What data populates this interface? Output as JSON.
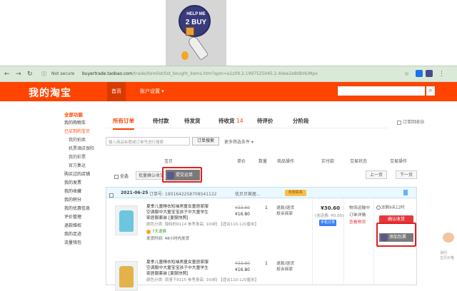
{
  "logo": {
    "line1": "HELP ME",
    "line2": "2 BUY"
  },
  "browser": {
    "secure_label": "Not secure",
    "url_domain": "buyertrade.taobao.com",
    "url_path": "/trade/itemlist/list_bought_items.htm?spm=a1z09.2.1997525045.2.4dee2e8dbHUMpx"
  },
  "nav": {
    "brand": "我的淘宝",
    "tabs": [
      "首页",
      "账户设置 ▾"
    ]
  },
  "sidebar": {
    "items": [
      {
        "label": "全部功能",
        "style": "head"
      },
      {
        "label": "我的购物车",
        "style": ""
      },
      {
        "label": "已买到的宝贝",
        "style": "hl"
      },
      {
        "label": "我的拍卖",
        "style": "sub"
      },
      {
        "label": "机票酒店保险",
        "style": "sub"
      },
      {
        "label": "我的彩票",
        "style": "sub"
      },
      {
        "label": "官方集运",
        "style": "sub"
      },
      {
        "label": "购买过的店铺",
        "style": ""
      },
      {
        "label": "我的发票",
        "style": ""
      },
      {
        "label": "我的收藏",
        "style": ""
      },
      {
        "label": "我的积分",
        "style": ""
      },
      {
        "label": "我的优惠信息",
        "style": ""
      },
      {
        "label": "评价管理",
        "style": ""
      },
      {
        "label": "退款维权",
        "style": ""
      },
      {
        "label": "我的足迹",
        "style": ""
      },
      {
        "label": "流量钱包",
        "style": ""
      }
    ]
  },
  "tabs": [
    {
      "label": "所有订单",
      "count": ""
    },
    {
      "label": "待付款",
      "count": ""
    },
    {
      "label": "待发货",
      "count": ""
    },
    {
      "label": "待收货",
      "count": "14"
    },
    {
      "label": "待评价",
      "count": ""
    },
    {
      "label": "分阶段",
      "count": ""
    }
  ],
  "recycle_label": "订单回收站",
  "search": {
    "placeholder": "输入商品标题或订单号进行搜索",
    "button": "订单搜索",
    "more": "更多筛选条件 ▾"
  },
  "table_header": [
    "宝贝",
    "单价",
    "数量",
    "商品操作",
    "实付款",
    "交易状态",
    "交易操作"
  ],
  "toolbar": {
    "select_all": "全选",
    "batch_confirm": "批量确认收货",
    "submit_order": "提交运单",
    "prev_page": "上一页",
    "next_page": "下一页"
  },
  "order": {
    "date": "2021-06-25",
    "order_no": "订单号: 1901642258708541122",
    "shop": "优贝贝家居...",
    "shop_badge": "和我联系",
    "total": "¥30.60",
    "total_sub": "(含运费: ¥0.00)",
    "pay_badge": "手机订单",
    "status_lines": [
      "物流运输中",
      "订单详情",
      "查看物流"
    ],
    "deadline": "还剩9天12时",
    "confirm_btn": "确认收货",
    "add_package": "添加包裹",
    "products": [
      {
        "name": "夏季儿童睡衣短袖男童女童居家服空调服中大童宝宝孩子中大童学生家居服套装 [夏服快照]",
        "meta": "颜色分类: 独特的9114  参考身高: 100码 【适合110-120厘米】",
        "tag": "7天退换",
        "ship": "发货时间: 48小时内发货",
        "price_old": "¥33.60",
        "price_new": "¥16.80",
        "qty": "1",
        "ops": [
          "退款/退货",
          "投诉商家"
        ],
        "color": "#6cc6dd"
      },
      {
        "name": "夏季儿童睡衣短袖男童女童居家服空调服中大童宝宝孩子中大童学生家居服套装 [夏服快照]",
        "meta": "颜色分类: 浪漫下9115  参考身高: 100码 【适合110-120厘米】",
        "tag": "",
        "ship": "",
        "price_old": "¥33.60",
        "price_new": "¥16.80",
        "qty": "1",
        "ops": [
          "退款/退货",
          "投诉商家"
        ],
        "color": "#e3b24a"
      }
    ]
  },
  "float_help": [
    "询问",
    "宝贝价格"
  ],
  "colors": {
    "brand": "#ff4400",
    "accent": "#f40",
    "confirm": "#e4393c"
  }
}
